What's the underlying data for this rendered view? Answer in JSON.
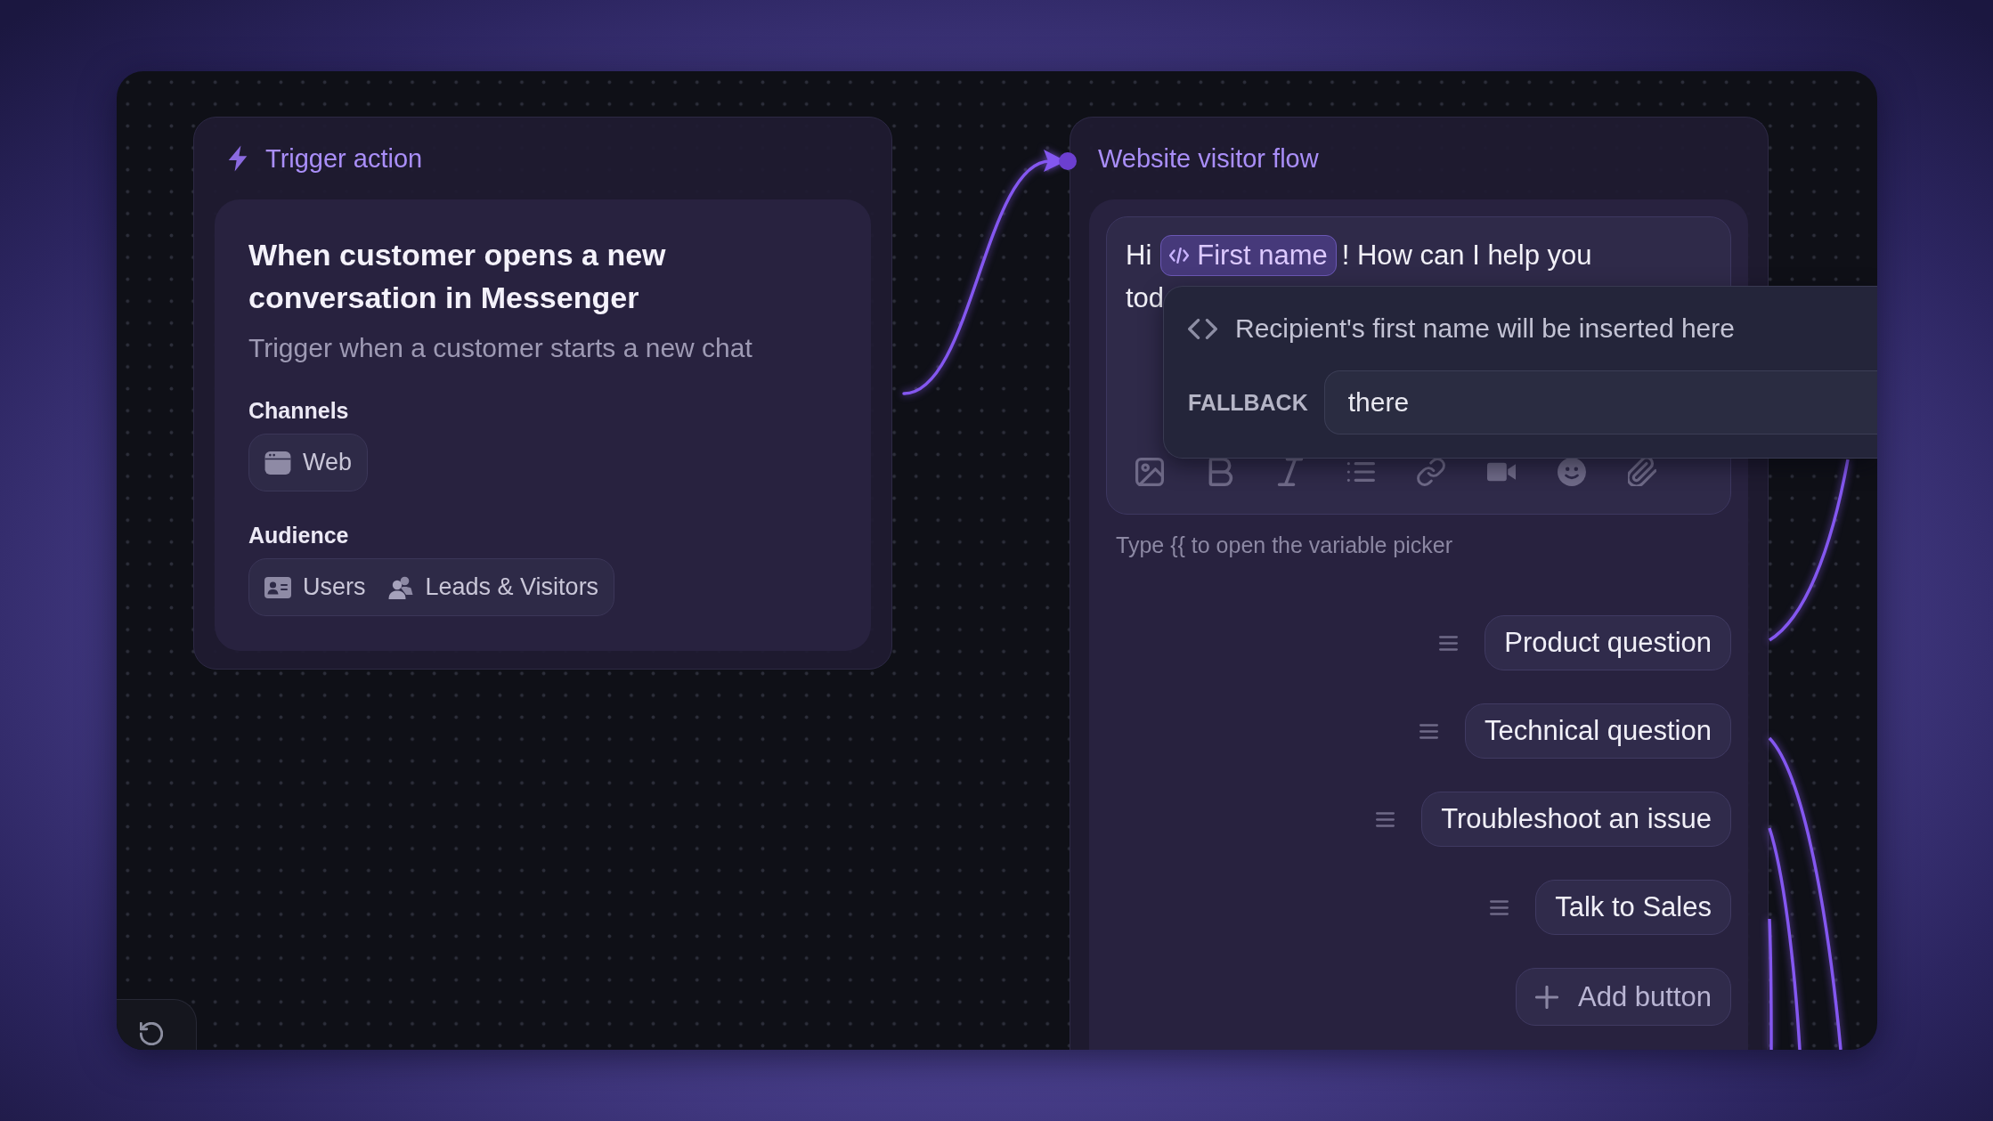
{
  "trigger": {
    "header": "Trigger action",
    "title": "When customer opens a new conversation in Messenger",
    "description": "Trigger when a customer starts a new chat",
    "channels": {
      "label": "Channels",
      "items": [
        {
          "label": "Web",
          "kind": "web"
        }
      ]
    },
    "audience": {
      "label": "Audience",
      "items": [
        {
          "label": "Users",
          "kind": "users"
        },
        {
          "label": "Leads & Visitors",
          "kind": "leads"
        }
      ]
    }
  },
  "flow": {
    "header": "Website visitor flow",
    "message": {
      "parts": [
        {
          "kind": "text",
          "text": "Hi"
        },
        {
          "kind": "variable",
          "text": "First name"
        },
        {
          "kind": "text",
          "text": "! How can I help you tod"
        }
      ]
    },
    "variable_popover": {
      "description": "Recipient's first name will be inserted here",
      "fallback_label": "FALLBACK",
      "fallback_value": "there"
    },
    "hint": "Type {{ to open the variable picker",
    "buttons": [
      {
        "label": "Product question"
      },
      {
        "label": "Technical question"
      },
      {
        "label": "Troubleshoot an issue"
      },
      {
        "label": "Talk to Sales"
      }
    ],
    "add_button": "Add button"
  }
}
